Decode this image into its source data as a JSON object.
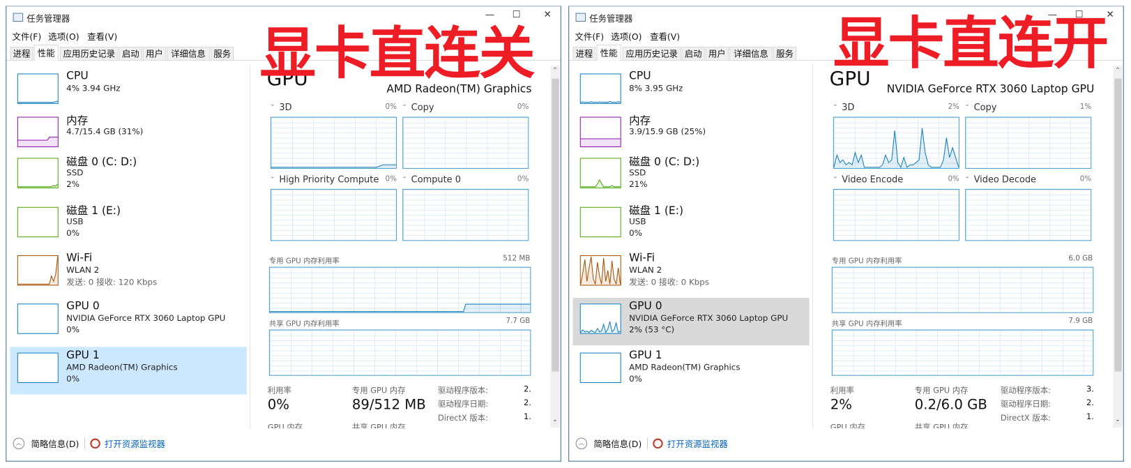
{
  "overlay": {
    "left_caption": "显卡直连关",
    "right_caption": "显卡直连开",
    "color": "#ee1c25"
  },
  "windows": [
    {
      "title": "任务管理器",
      "controls": {
        "minimize": "—",
        "maximize": "☐",
        "close": "✕"
      },
      "menu": [
        "文件(F)",
        "选项(O)",
        "查看(V)"
      ],
      "tabs": [
        "进程",
        "性能",
        "应用历史记录",
        "启动",
        "用户",
        "详细信息",
        "服务"
      ],
      "selected_tab": 1,
      "sidebar": [
        {
          "title": "CPU",
          "lines": [
            "4% 3.94 GHz"
          ],
          "color": "#117dbb",
          "samples": [
            0,
            0,
            0,
            0,
            0,
            0,
            0,
            0,
            0,
            0,
            0,
            0,
            0,
            0,
            0,
            0,
            0,
            0,
            3,
            5
          ]
        },
        {
          "title": "内存",
          "lines": [
            "4.7/15.4 GB (31%)"
          ],
          "color": "#8b12ae",
          "samples": [
            20,
            20,
            20,
            20,
            20,
            20,
            20,
            20,
            20,
            20,
            20,
            20,
            20,
            20,
            20,
            31,
            31,
            31,
            31,
            31
          ]
        },
        {
          "title": "磁盘 0 (C: D:)",
          "lines": [
            "SSD",
            "2%"
          ],
          "color": "#4da60c",
          "samples": [
            0,
            0,
            0,
            0,
            0,
            0,
            0,
            0,
            0,
            0,
            0,
            0,
            0,
            0,
            0,
            0,
            0,
            5,
            2,
            10
          ]
        },
        {
          "title": "磁盘 1 (E:)",
          "lines": [
            "USB",
            "0%"
          ],
          "color": "#4da60c",
          "samples": []
        },
        {
          "title": "Wi-Fi",
          "lines": [
            "WLAN 2",
            "发送: 0 接收: 120 Kbps"
          ],
          "color": "#a74f01",
          "samples": [
            0,
            0,
            0,
            0,
            0,
            0,
            0,
            0,
            0,
            0,
            0,
            0,
            0,
            0,
            0,
            0,
            30,
            10,
            35,
            100
          ]
        },
        {
          "title": "GPU 0",
          "lines": [
            "NVIDIA GeForce RTX 3060 Laptop GPU",
            "0%"
          ],
          "color": "#117dbb",
          "samples": []
        },
        {
          "title": "GPU 1",
          "lines": [
            "AMD Radeon(TM) Graphics",
            "0%"
          ],
          "color": "#117dbb",
          "samples": []
        }
      ],
      "selected_item": 6,
      "selected_bg": "#cce8ff",
      "detail": {
        "heading": "GPU",
        "device": "AMD Radeon(TM) Graphics",
        "engines": [
          {
            "label": "3D",
            "percent": "0%",
            "samples": [
              0,
              0,
              0,
              0,
              0,
              0,
              0,
              0,
              0,
              0,
              0,
              0,
              0,
              0,
              0,
              0,
              0,
              1,
              1,
              1
            ]
          },
          {
            "label": "Copy",
            "percent": "0%",
            "samples": []
          },
          {
            "label": "High Priority Compute",
            "percent": "0%",
            "samples": []
          },
          {
            "label": "Compute 0",
            "percent": "0%",
            "samples": []
          }
        ],
        "dedicated_label": "专用 GPU 内存利用率",
        "dedicated_max": "512 MB",
        "dedicated_samples": [
          0,
          0,
          0,
          0,
          0,
          0,
          0,
          0,
          0,
          0,
          0,
          0,
          0,
          0,
          0,
          0,
          0,
          0,
          0,
          0,
          0,
          0,
          0,
          0,
          0,
          0,
          0,
          0,
          0,
          0,
          0,
          0,
          0,
          0,
          0,
          0,
          0,
          0,
          0,
          0,
          0,
          0,
          0,
          0,
          0,
          0,
          0,
          0,
          0,
          0,
          0,
          0,
          0,
          0,
          0,
          0,
          0,
          0,
          0,
          0,
          0,
          0,
          0,
          0,
          0,
          0,
          0,
          0,
          0,
          0,
          0,
          0,
          0,
          0,
          0,
          0,
          0,
          0,
          0,
          0,
          0,
          0,
          0,
          0,
          0,
          0,
          0,
          0,
          0,
          0,
          0,
          17,
          17,
          17,
          17,
          17,
          17,
          17,
          17,
          17,
          17,
          17,
          17,
          17,
          17,
          17,
          17,
          17,
          17,
          17,
          17,
          17,
          17,
          17,
          17,
          17,
          17,
          17,
          17,
          17,
          17,
          17
        ],
        "shared_label": "共享 GPU 内存利用率",
        "shared_max": "7.7 GB",
        "stats": {
          "util_label": "利用率",
          "util_value": "0%",
          "ded_label": "专用 GPU 内存",
          "ded_value": "89/512 MB",
          "gpumem_label": "GPU 内存",
          "shared_label": "共享 GPU 内存",
          "props": [
            {
              "k": "驱动程序版本:",
              "v": "2."
            },
            {
              "k": "驱动程序日期:",
              "v": "2."
            },
            {
              "k": "DirectX 版本:",
              "v": "1."
            }
          ]
        }
      },
      "footer": {
        "summary": "简略信息(D)",
        "resmon": "打开资源监视器"
      }
    },
    {
      "title": "任务管理器",
      "controls": {
        "minimize": "—",
        "maximize": "☐",
        "close": "✕"
      },
      "menu": [
        "文件(F)",
        "选项(O)",
        "查看(V)"
      ],
      "tabs": [
        "进程",
        "性能",
        "应用历史记录",
        "启动",
        "用户",
        "详细信息",
        "服务"
      ],
      "selected_tab": 1,
      "sidebar": [
        {
          "title": "CPU",
          "lines": [
            "8% 3.95 GHz"
          ],
          "color": "#117dbb",
          "samples": [
            0,
            2,
            0,
            1,
            0,
            3,
            0,
            1,
            0,
            2,
            0,
            1,
            0,
            0,
            4,
            0,
            1,
            0,
            3,
            0
          ]
        },
        {
          "title": "内存",
          "lines": [
            "3.9/15.9 GB (25%)"
          ],
          "color": "#8b12ae",
          "samples": [
            25,
            25,
            25,
            25,
            25,
            25,
            25,
            25,
            25,
            25,
            25,
            25,
            25,
            25,
            25,
            25,
            25,
            25,
            25,
            25
          ]
        },
        {
          "title": "磁盘 0 (C: D:)",
          "lines": [
            "SSD",
            "21%"
          ],
          "color": "#4da60c",
          "samples": [
            0,
            0,
            0,
            0,
            0,
            0,
            0,
            0,
            10,
            25,
            12,
            0,
            0,
            0,
            0,
            5,
            0,
            0,
            0,
            0
          ]
        },
        {
          "title": "磁盘 1 (E:)",
          "lines": [
            "USB",
            "0%"
          ],
          "color": "#4da60c",
          "samples": []
        },
        {
          "title": "Wi-Fi",
          "lines": [
            "WLAN 2",
            "发送: 0 接收: 0 Kbps"
          ],
          "color": "#a74f01",
          "samples": [
            0,
            40,
            90,
            10,
            60,
            100,
            20,
            0,
            80,
            30,
            0,
            95,
            10,
            50,
            0,
            85,
            20,
            0,
            60,
            0
          ]
        },
        {
          "title": "GPU 0",
          "lines": [
            "NVIDIA GeForce RTX 3060 Laptop GPU",
            "2% (53 °C)"
          ],
          "color": "#117dbb",
          "samples": [
            0,
            10,
            2,
            5,
            0,
            8,
            3,
            0,
            15,
            2,
            5,
            30,
            0,
            12,
            40,
            2,
            10,
            35,
            0,
            5
          ]
        },
        {
          "title": "GPU 1",
          "lines": [
            "AMD Radeon(TM) Graphics",
            "0%"
          ],
          "color": "#117dbb",
          "samples": []
        }
      ],
      "selected_item": 5,
      "selected_bg": "#d9d9d9",
      "detail": {
        "heading": "GPU",
        "device": "NVIDIA GeForce RTX 3060 Laptop GPU",
        "engines": [
          {
            "label": "3D",
            "percent": "2%",
            "samples": [
              0,
              5,
              2,
              3,
              1,
              2,
              1,
              6,
              2,
              5,
              0,
              0,
              0,
              0,
              0,
              0,
              1,
              5,
              2,
              3,
              15,
              2,
              0,
              4,
              0,
              1,
              1,
              2,
              3,
              16,
              6,
              1,
              0,
              0,
              0,
              0,
              3,
              12,
              4,
              8,
              4,
              0
            ]
          },
          {
            "label": "Copy",
            "percent": "1%",
            "samples": []
          },
          {
            "label": "Video Encode",
            "percent": "0%",
            "samples": []
          },
          {
            "label": "Video Decode",
            "percent": "0%",
            "samples": []
          }
        ],
        "dedicated_label": "专用 GPU 内存利用率",
        "dedicated_max": "6.0 GB",
        "dedicated_samples": [],
        "shared_label": "共享 GPU 内存利用率",
        "shared_max": "7.9 GB",
        "stats": {
          "util_label": "利用率",
          "util_value": "2%",
          "ded_label": "专用 GPU 内存",
          "ded_value": "0.2/6.0 GB",
          "gpumem_label": "GPU 内存",
          "shared_label": "共享 GPU 内存",
          "props": [
            {
              "k": "驱动程序版本:",
              "v": "3."
            },
            {
              "k": "驱动程序日期:",
              "v": "2."
            },
            {
              "k": "DirectX 版本:",
              "v": "1."
            }
          ]
        }
      },
      "footer": {
        "summary": "简略信息(D)",
        "resmon": "打开资源监视器"
      }
    }
  ]
}
